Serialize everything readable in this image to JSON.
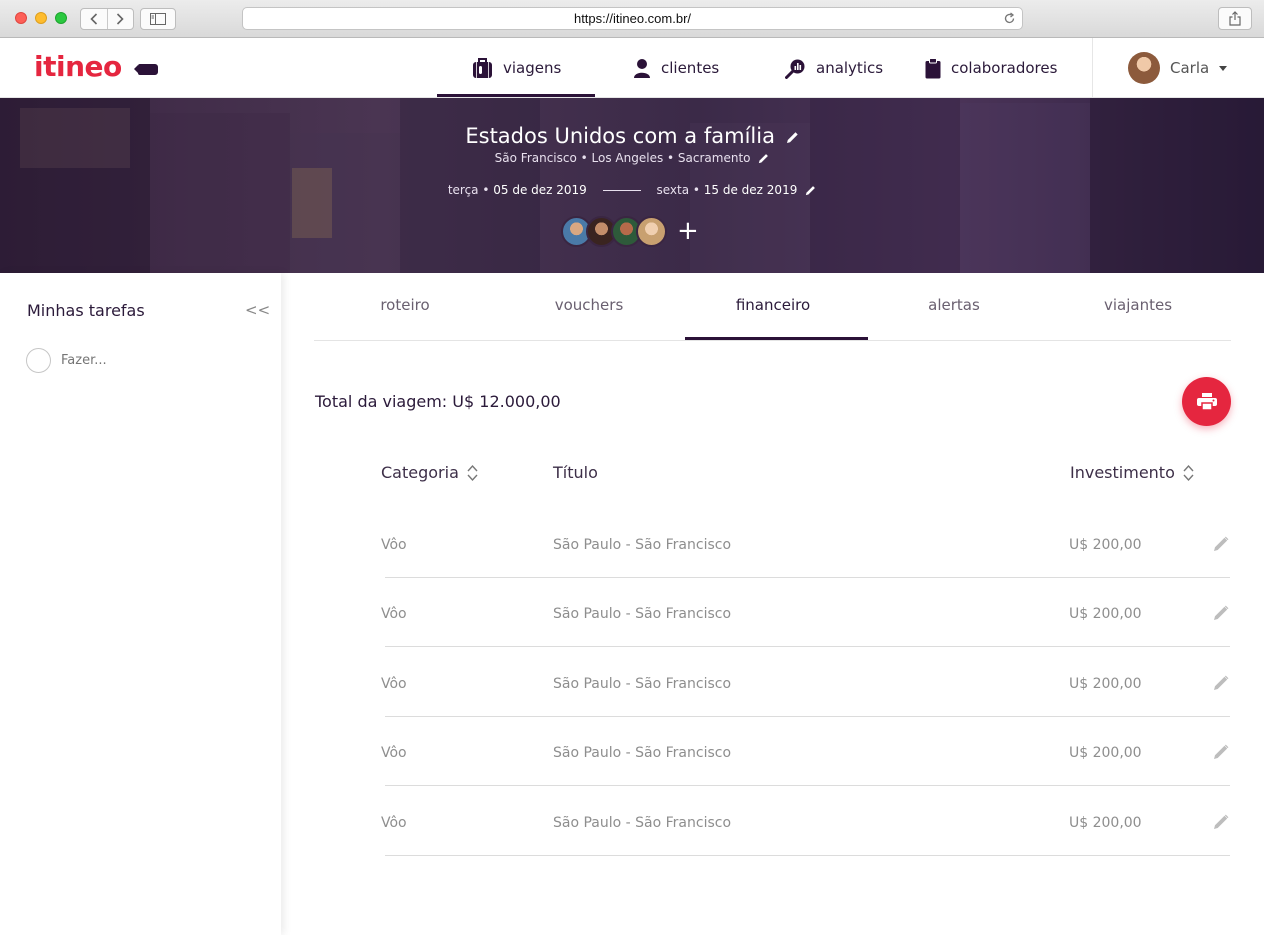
{
  "browser": {
    "url": "https://itineo.com.br/"
  },
  "brand": {
    "logo_text": "itineo",
    "accent_color": "#e5263f",
    "dark_color": "#2b1238"
  },
  "nav": {
    "items": [
      {
        "label": "viagens",
        "icon": "suitcase-icon",
        "active": true
      },
      {
        "label": "clientes",
        "icon": "person-icon",
        "active": false
      },
      {
        "label": "analytics",
        "icon": "magnifier-chart-icon",
        "active": false
      },
      {
        "label": "colaboradores",
        "icon": "clipboard-icon",
        "active": false
      }
    ],
    "user_name": "Carla"
  },
  "trip": {
    "title": "Estados Unidos com a família",
    "cities": "São Francisco • Los Angeles • Sacramento",
    "start_day": "terça",
    "start_date": "05 de dez 2019",
    "end_day": "sexta",
    "end_date": "15 de dez 2019",
    "add_traveler": "+"
  },
  "sidebar": {
    "title": "Minhas tarefas",
    "collapse": "<<",
    "task_placeholder": "Fazer..."
  },
  "tabs": [
    {
      "label": "roteiro",
      "active": false
    },
    {
      "label": "vouchers",
      "active": false
    },
    {
      "label": "financeiro",
      "active": true
    },
    {
      "label": "alertas",
      "active": false
    },
    {
      "label": "viajantes",
      "active": false
    }
  ],
  "financial": {
    "total_label": "Total da viagem: U$ 12.000,00",
    "columns": {
      "category": "Categoria",
      "title": "Título",
      "investment": "Investimento"
    },
    "rows": [
      {
        "category": "Vôo",
        "title": "São Paulo - São Francisco",
        "investment": "U$ 200,00"
      },
      {
        "category": "Vôo",
        "title": "São Paulo - São Francisco",
        "investment": "U$ 200,00"
      },
      {
        "category": "Vôo",
        "title": "São Paulo - São Francisco",
        "investment": "U$ 200,00"
      },
      {
        "category": "Vôo",
        "title": "São Paulo - São Francisco",
        "investment": "U$ 200,00"
      },
      {
        "category": "Vôo",
        "title": "São Paulo - São Francisco",
        "investment": "U$ 200,00"
      }
    ]
  }
}
